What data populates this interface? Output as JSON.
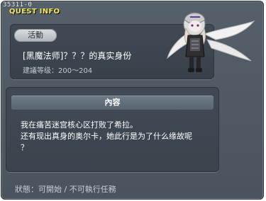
{
  "window": {
    "quest_id": "35311-0",
    "title": "QUEST INFO"
  },
  "header": {
    "tag": "活動",
    "quest_title": "[黑魔法师]？？？的真实身份",
    "recommended_level": "建議等级：200～204"
  },
  "content": {
    "header": "內容",
    "lines": [
      "我在痛苦迷宫核心区打败了希拉。",
      "还有现出真身的奥尔卡，她此行是为了什么缘故呢",
      "？"
    ]
  },
  "status": {
    "text": "狀態：可開始 / 不可執行任務"
  },
  "colors": {
    "window_bg": "#4f5963",
    "panel_bg": "#3d464f",
    "title_yellow": "#f4e85c",
    "header_bar": "#647280",
    "badge": "#c9cdd1"
  }
}
